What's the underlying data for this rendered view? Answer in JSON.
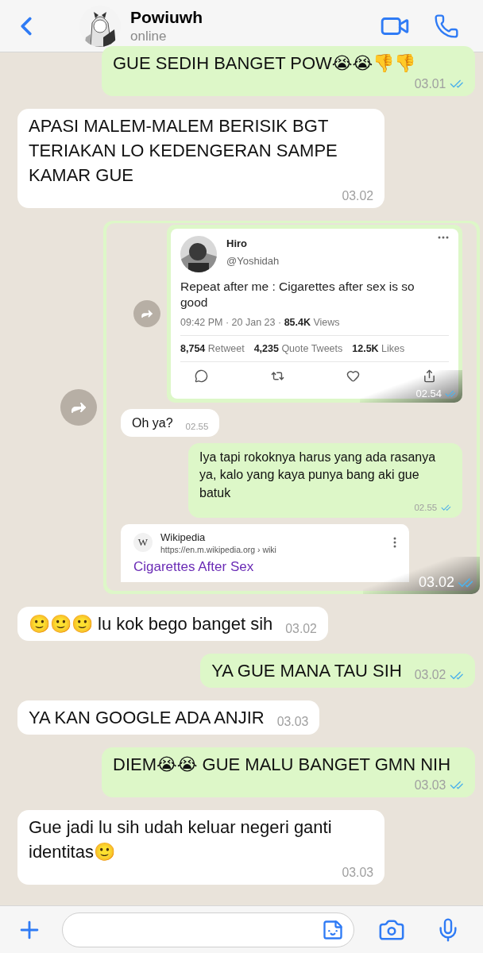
{
  "header": {
    "contact_name": "Powiuwh",
    "status": "online"
  },
  "messages": [
    {
      "kind": "text",
      "outgoing": true,
      "text": "GUE SEDIH BANGET POW😭😭👎👎",
      "time": "03.01",
      "read": true
    },
    {
      "kind": "text",
      "outgoing": false,
      "text": "APASI MALEM-MALEM BERISIK BGT TERIAKAN LO KEDENGERAN SAMPE KAMAR GUE",
      "time": "03.02"
    },
    {
      "kind": "screenshot",
      "outgoing": true,
      "time": "03.02",
      "read": true,
      "screenshot": {
        "tweet_message": {
          "name": "Hiro",
          "handle": "@Yoshidah",
          "text": "Repeat after me : Cigarettes after sex is so good",
          "meta": "09:42 PM · 20 Jan 23 · **85.4K** Views",
          "stats": [
            "**8,754** Retweet",
            "**4,235** Quote Tweets",
            "**12.5K** Likes"
          ],
          "time": "02.54",
          "read": true
        },
        "messages": [
          {
            "outgoing": false,
            "text": "Oh ya?",
            "time": "02.55"
          },
          {
            "outgoing": true,
            "text": "Iya tapi rokoknya harus yang ada rasanya ya, kalo yang kaya punya bang aki gue batuk",
            "time": "02.55",
            "read": true
          }
        ],
        "link_card": {
          "logo": "W",
          "site": "Wikipedia",
          "url": "https://en.m.wikipedia.org › wiki",
          "title": "Cigarettes After Sex"
        }
      }
    },
    {
      "kind": "text",
      "outgoing": false,
      "text": "🙂🙂🙂 lu kok bego banget sih",
      "time": "03.02"
    },
    {
      "kind": "text",
      "outgoing": true,
      "text": "YA GUE MANA TAU SIH",
      "time": "03.02",
      "read": true
    },
    {
      "kind": "text",
      "outgoing": false,
      "text": "YA KAN GOOGLE ADA ANJIR",
      "time": "03.03"
    },
    {
      "kind": "text",
      "outgoing": true,
      "text": "DIEM😭😭 GUE MALU BANGET GMN NIH",
      "time": "03.03",
      "read": true
    },
    {
      "kind": "text",
      "outgoing": false,
      "text": "Gue jadi lu sih udah keluar negeri ganti identitas🙂",
      "time": "03.03"
    }
  ]
}
